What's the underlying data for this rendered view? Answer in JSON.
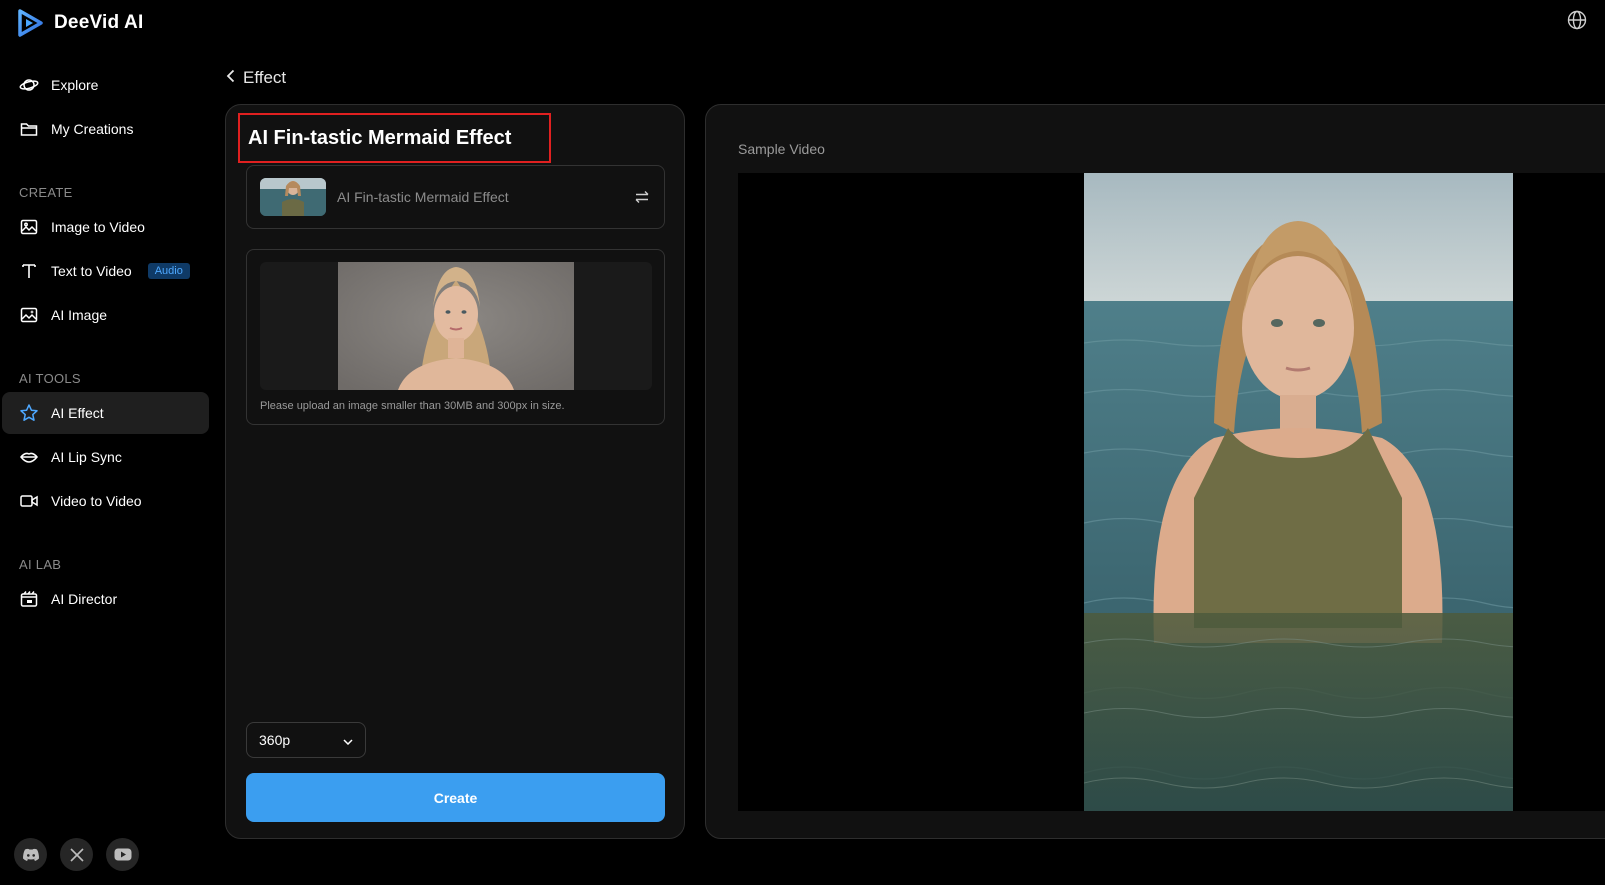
{
  "app": {
    "name": "DeeVid AI"
  },
  "sidebar": {
    "items_top": [
      {
        "label": "Explore",
        "icon": "planet-icon"
      },
      {
        "label": "My Creations",
        "icon": "folder-icon"
      }
    ],
    "section_create": "CREATE",
    "items_create": [
      {
        "label": "Image to Video",
        "icon": "image-icon"
      },
      {
        "label": "Text to Video",
        "icon": "text-icon",
        "badge": "Audio"
      },
      {
        "label": "AI Image",
        "icon": "ai-image-icon"
      }
    ],
    "section_tools": "AI TOOLS",
    "items_tools": [
      {
        "label": "AI Effect",
        "icon": "star-icon",
        "active": true
      },
      {
        "label": "AI Lip Sync",
        "icon": "lips-icon"
      },
      {
        "label": "Video to Video",
        "icon": "video-camera-icon"
      }
    ],
    "section_lab": "AI LAB",
    "items_lab": [
      {
        "label": "AI Director",
        "icon": "director-icon"
      }
    ]
  },
  "breadcrumb": {
    "label": "Effect"
  },
  "effect_panel": {
    "title": "AI Fin-tastic Mermaid Effect",
    "selected_effect": "AI Fin-tastic Mermaid Effect",
    "upload_hint": "Please upload an image smaller than 30MB and 300px in size.",
    "resolution": "360p",
    "create_label": "Create"
  },
  "preview": {
    "label": "Sample Video"
  },
  "colors": {
    "accent": "#3b9ef0",
    "highlight_border": "#e02020",
    "badge_text": "#4ea8ff"
  }
}
